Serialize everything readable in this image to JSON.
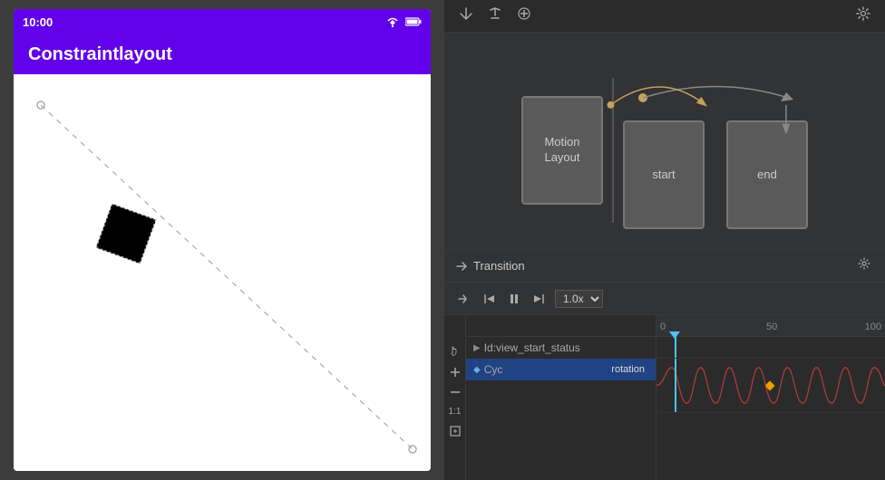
{
  "left": {
    "statusBar": {
      "time": "10:00",
      "icons": [
        "wifi",
        "battery"
      ]
    },
    "appBar": {
      "title": "Constraintlayout"
    }
  },
  "right": {
    "toolbar": {
      "icons": [
        "import-icon",
        "export-icon",
        "add-icon",
        "settings-icon"
      ]
    },
    "diagram": {
      "motionLayoutNode": {
        "label1": "Motion",
        "label2": "Layout"
      },
      "startNode": {
        "label": "start"
      },
      "endNode": {
        "label": "end"
      }
    },
    "transition": {
      "header": "Transition",
      "settingsIcon": "settings-icon"
    },
    "playback": {
      "controls": [
        "arrow-right",
        "skip-start",
        "pause",
        "skip-end"
      ],
      "speed": "1.0x"
    },
    "timeline": {
      "ruler": {
        "marks": [
          "0",
          "50",
          "100"
        ]
      },
      "tracks": [
        {
          "id": "Id:view_start_status",
          "label": "Id:view_start_status",
          "isGroup": true
        },
        {
          "id": "cyc-rotation",
          "icon": "◆",
          "label": "Cyc",
          "type": "rotation",
          "isSelected": true
        }
      ]
    },
    "sideTools": [
      "hand-tool",
      "plus-tool",
      "minus-tool",
      "fit-tool",
      "expand-tool"
    ]
  }
}
